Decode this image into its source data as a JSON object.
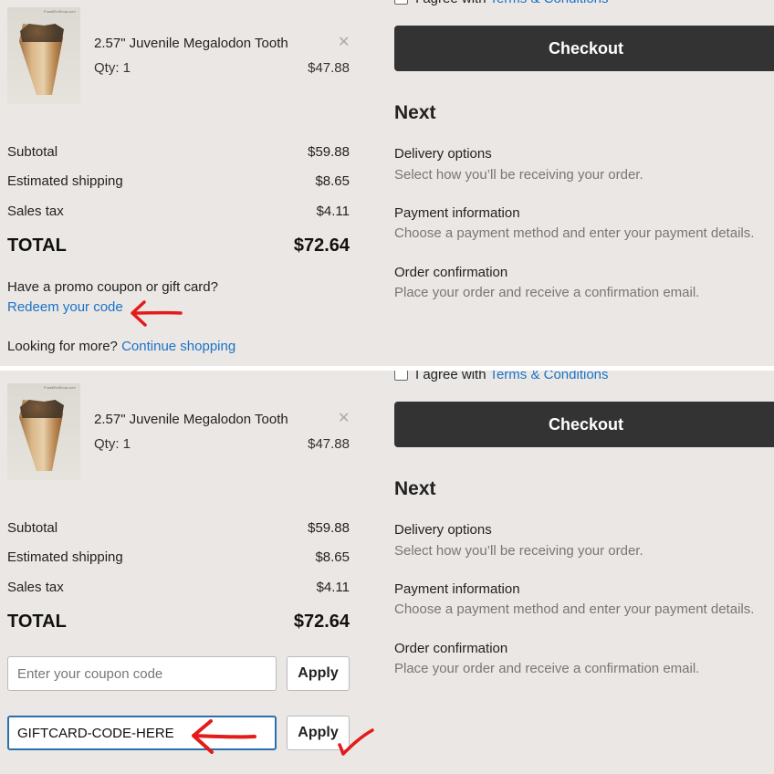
{
  "cart": {
    "item": {
      "brand_mark": "FossilEraShop.com",
      "name": "2.57\" Juvenile Megalodon Tooth",
      "qty": "Qty: 1",
      "price": "$47.88"
    },
    "subtotal_label": "Subtotal",
    "subtotal_value": "$59.88",
    "shipping_label": "Estimated shipping",
    "shipping_value": "$8.65",
    "tax_label": "Sales tax",
    "tax_value": "$4.11",
    "total_label": "TOTAL",
    "total_value": "$72.64",
    "promo_question": "Have a promo coupon or gift card?",
    "redeem_link": "Redeem your code",
    "more_prefix": "Looking for more?",
    "continue_link": "Continue shopping"
  },
  "checkout": {
    "terms_prefix": "I agree with",
    "terms_link": "Terms & Conditions",
    "button_label": "Checkout",
    "next_heading": "Next",
    "steps": [
      {
        "title": "Delivery options",
        "desc": "Select how you’ll be receiving your order."
      },
      {
        "title": "Payment information",
        "desc": "Choose a payment method and enter your payment details."
      },
      {
        "title": "Order confirmation",
        "desc": "Place your order and receive a confirmation email."
      }
    ]
  },
  "coupon": {
    "placeholder": "Enter your coupon code",
    "apply_label": "Apply",
    "gift_value": "GIFTCARD-CODE-HERE",
    "gift_apply_label": "Apply"
  },
  "colors": {
    "panel_bg": "#ebe7e4",
    "link": "#1a73c7",
    "checkout_bg": "#333333",
    "annotation": "#e31b1b"
  },
  "annotations": [
    "red-arrow",
    "red-checkmark"
  ]
}
